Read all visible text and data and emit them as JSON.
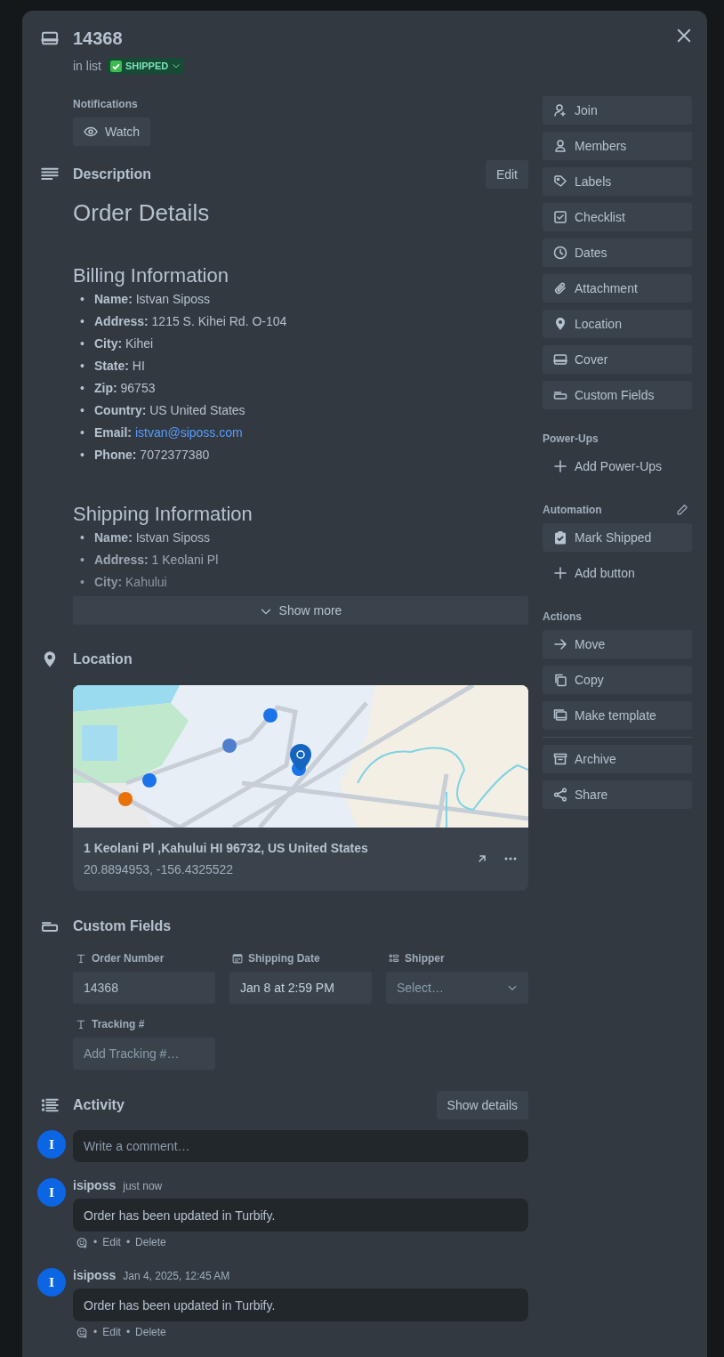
{
  "card": {
    "title": "14368",
    "list_prefix": "in list",
    "list_name": "SHIPPED"
  },
  "notifications": {
    "label": "Notifications",
    "button": "Watch"
  },
  "description": {
    "title": "Description",
    "edit": "Edit",
    "heading": "Order Details",
    "bullet": "•",
    "sections": [
      {
        "title": "Billing Information",
        "faded": false,
        "items": [
          {
            "label": "Name:",
            "value": "Istvan Siposs",
            "kind": "text"
          },
          {
            "label": "Address:",
            "value": "1215 S. Kihei Rd. O-104",
            "kind": "text"
          },
          {
            "label": "City:",
            "value": "Kihei",
            "kind": "text"
          },
          {
            "label": "State:",
            "value": "HI",
            "kind": "text"
          },
          {
            "label": "Zip:",
            "value": "96753",
            "kind": "text"
          },
          {
            "label": "Country:",
            "value": "US United States",
            "kind": "text"
          },
          {
            "label": "Email:",
            "value": "istvan@siposs.com",
            "kind": "link"
          },
          {
            "label": "Phone:",
            "value": "7072377380",
            "kind": "text"
          }
        ]
      },
      {
        "title": "Shipping Information",
        "faded": true,
        "items": [
          {
            "label": "Name:",
            "value": "Istvan Siposs",
            "kind": "text"
          },
          {
            "label": "Address:",
            "value": "1 Keolani Pl",
            "kind": "text"
          },
          {
            "label": "City:",
            "value": "Kahului",
            "kind": "text"
          }
        ]
      }
    ],
    "show_more": "Show more"
  },
  "location": {
    "title": "Location",
    "address": "1 Keolani Pl ,Kahului HI 96732, US United States",
    "coordinates": "20.8894953, -156.4325522"
  },
  "custom_fields": {
    "title": "Custom Fields",
    "fields": [
      {
        "label": "Order Number",
        "kind": "text",
        "value": "14368"
      },
      {
        "label": "Shipping Date",
        "kind": "date",
        "value": "Jan 8 at 2:59 PM"
      },
      {
        "label": "Shipper",
        "kind": "list",
        "placeholder": "Select…"
      },
      {
        "label": "Tracking #",
        "kind": "text",
        "placeholder": "Add Tracking #…"
      }
    ]
  },
  "activity": {
    "title": "Activity",
    "show_details": "Show details",
    "avatar": "I",
    "comment_placeholder": "Write a comment…",
    "separator": "•",
    "comments": [
      {
        "author": "isiposs",
        "avatar": "I",
        "time": "just now",
        "text": "Order has been updated in Turbify.",
        "actions": [
          "Edit",
          "Delete"
        ]
      },
      {
        "author": "isiposs",
        "avatar": "I",
        "time": "Jan 4, 2025, 12:45 AM",
        "text": "Order has been updated in Turbify.",
        "actions": [
          "Edit",
          "Delete"
        ]
      }
    ]
  },
  "sidebar": {
    "buttons": [
      "Join",
      "Members",
      "Labels",
      "Checklist",
      "Dates",
      "Attachment",
      "Location",
      "Cover",
      "Custom Fields"
    ],
    "power_ups": {
      "title": "Power-Ups",
      "add": "Add Power-Ups"
    },
    "automation": {
      "title": "Automation",
      "buttons": [
        "Mark Shipped"
      ],
      "add": "Add button"
    },
    "actions": {
      "title": "Actions",
      "groups": [
        [
          "Move",
          "Copy",
          "Make template"
        ],
        [
          "Archive",
          "Share"
        ]
      ]
    }
  }
}
